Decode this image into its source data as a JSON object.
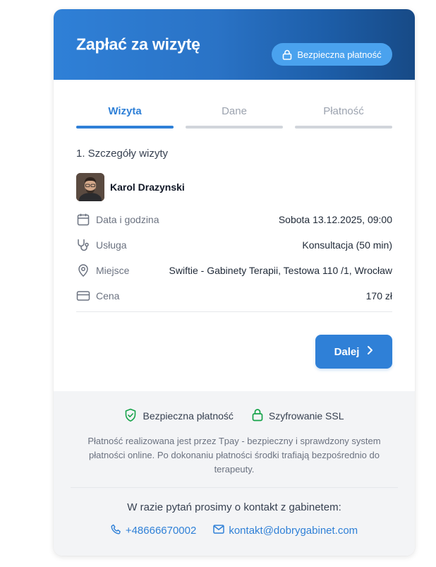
{
  "header": {
    "title": "Zapłać za wizytę",
    "secure_badge": "Bezpieczna płatność",
    "gradient_start": "#2f80d7",
    "gradient_end": "#174a86"
  },
  "tabs": [
    {
      "label": "Wizyta",
      "active": true
    },
    {
      "label": "Dane",
      "active": false
    },
    {
      "label": "Płatność",
      "active": false
    }
  ],
  "visit": {
    "section_title": "1. Szczegóły wizyty",
    "therapist_name": "Karol Drazynski",
    "rows": [
      {
        "icon": "calendar-icon",
        "label": "Data i godzina",
        "value": "Sobota 13.12.2025, 09:00"
      },
      {
        "icon": "stethoscope-icon",
        "label": "Usługa",
        "value": "Konsultacja (50 min)"
      },
      {
        "icon": "location-pin-icon",
        "label": "Miejsce",
        "value": "Swiftie - Gabinety Terapii, Testowa 110 /1, Wrocław"
      },
      {
        "icon": "credit-card-icon",
        "label": "Cena",
        "value": "170 zł"
      }
    ]
  },
  "actions": {
    "next_label": "Dalej"
  },
  "footer": {
    "badge_secure": "Bezpieczna płatność",
    "badge_ssl": "Szyfrowanie SSL",
    "info": "Płatność realizowana jest przez Tpay - bezpieczny i sprawdzony system płatności online. Po dokonaniu płatności środki trafiają bezpośrednio do terapeuty.",
    "contact_heading": "W razie pytań prosimy o kontakt z gabinetem:",
    "phone": "+48666670002",
    "email": "kontakt@dobrygabinet.com"
  },
  "colors": {
    "accent": "#2f80d7",
    "success": "#16a34a",
    "footer_bg": "#f3f4f6"
  }
}
